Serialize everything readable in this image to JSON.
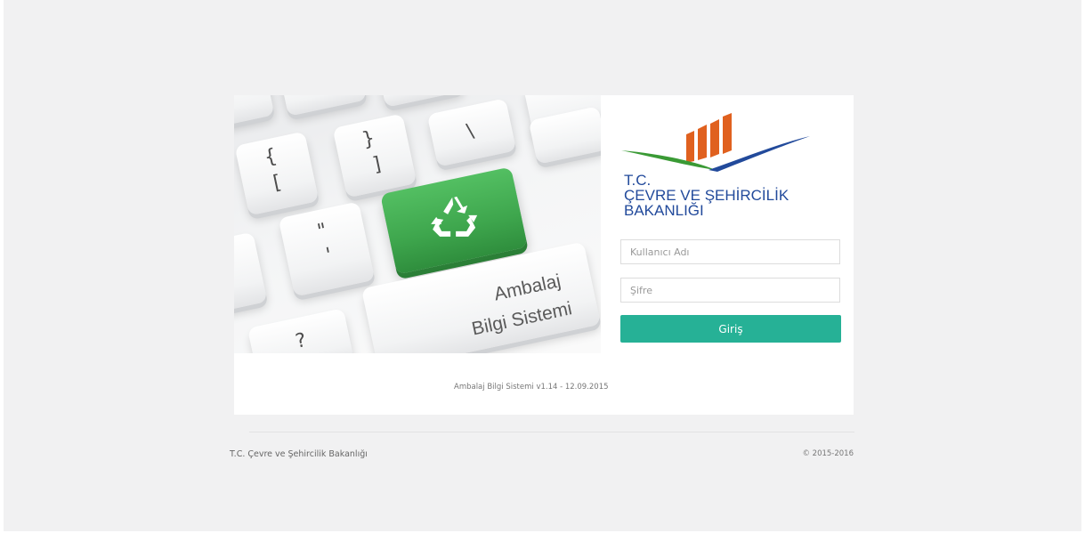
{
  "hero": {
    "caption_line1": "Ambalaj",
    "caption_line2": "Bilgi Sistemi",
    "icon": "recycle-icon"
  },
  "brand": {
    "line1": "T.C.",
    "line2": "ÇEVRE VE ŞEHİRCİLİK",
    "line3": "BAKANLIĞI",
    "colors": {
      "orange": "#e0611f",
      "green": "#3a9a35",
      "blue": "#224a9b"
    }
  },
  "form": {
    "username_placeholder": "Kullanıcı Adı",
    "password_placeholder": "Şifre",
    "login_label": "Giriş",
    "login_color": "#26b196"
  },
  "version_text": "Ambalaj Bilgi Sistemi v1.14 - 12.09.2015",
  "footer": {
    "left_text": "T.C. Çevre ve Şehircilik Bakanlığı",
    "right_text": "© 2015-2016"
  }
}
